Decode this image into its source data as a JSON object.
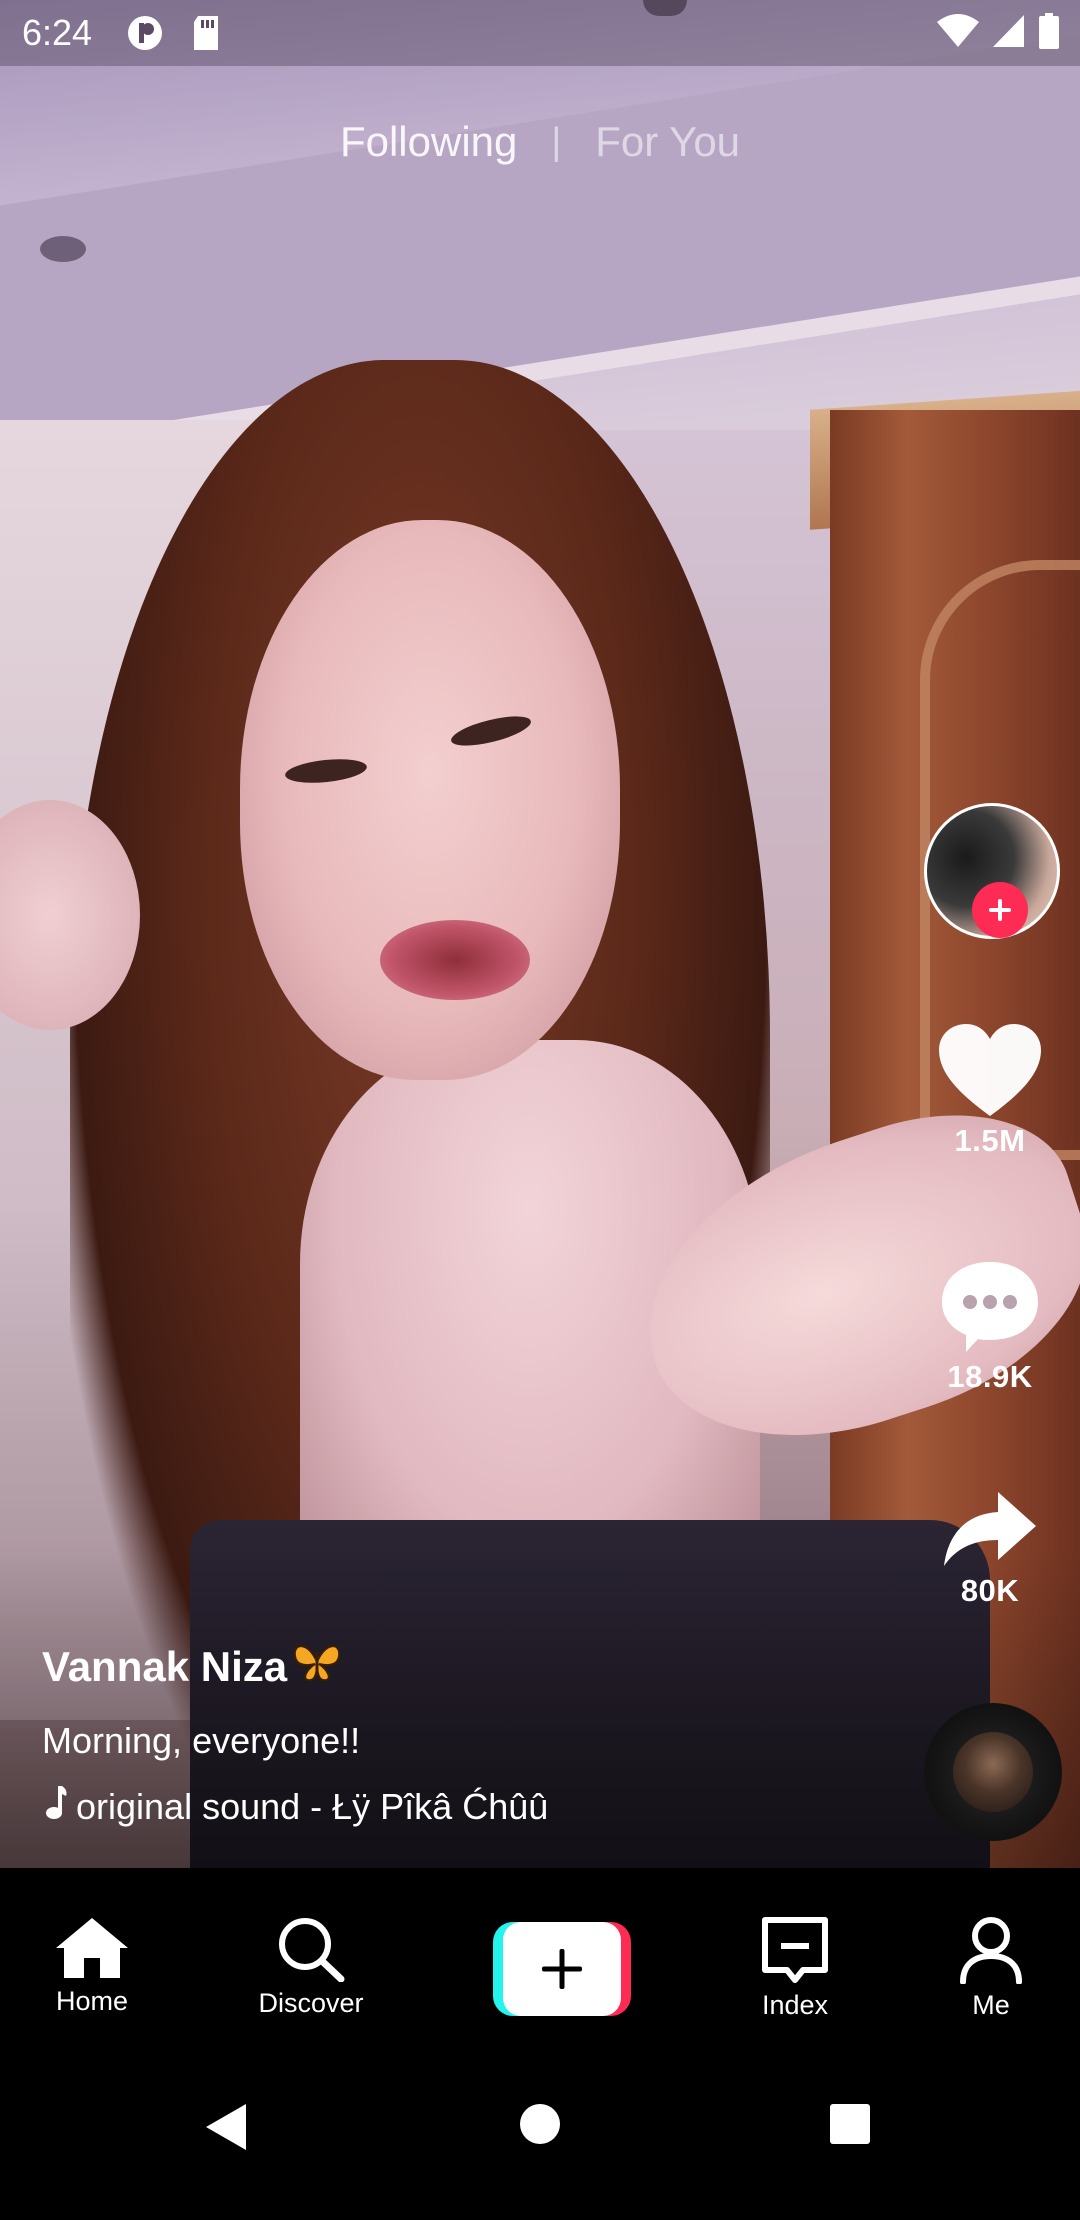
{
  "status_bar": {
    "time": "6:24",
    "left_icons": [
      "app-notification-icon",
      "sd-card-icon"
    ],
    "right_icons": [
      "wifi-icon",
      "cell-signal-icon",
      "battery-icon"
    ]
  },
  "feed_tabs": {
    "following": "Following",
    "separator": "|",
    "for_you": "For You",
    "active": "Following"
  },
  "post": {
    "author": "Vannak Niza",
    "author_emoji_icon": "butterfly-icon",
    "description": "Morning, everyone!!",
    "sound": "original sound - Łÿ Pîkâ Ćhûû",
    "likes": "1.5M",
    "comments": "18.9K",
    "shares": "80K"
  },
  "bottom_nav": {
    "items": [
      {
        "label": "Home",
        "icon": "home-icon"
      },
      {
        "label": "Discover",
        "icon": "search-icon"
      },
      {
        "label": "",
        "icon": "plus-icon"
      },
      {
        "label": "Index",
        "icon": "inbox-icon"
      },
      {
        "label": "Me",
        "icon": "person-icon"
      }
    ]
  },
  "colors": {
    "accent_red": "#fe2c55",
    "accent_cyan": "#25f4ee",
    "nav_background": "#000000"
  }
}
